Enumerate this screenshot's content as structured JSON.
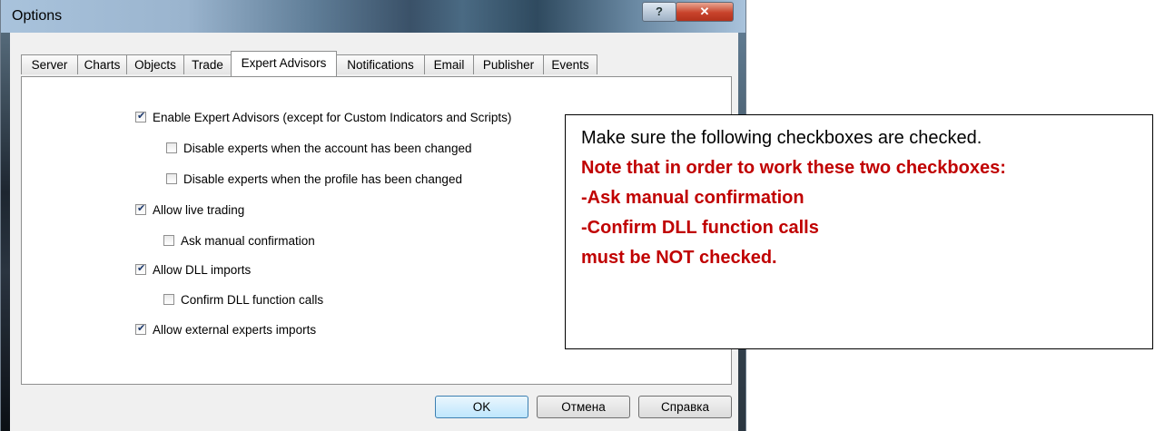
{
  "window": {
    "title": "Options"
  },
  "tabs": [
    "Server",
    "Charts",
    "Objects",
    "Trade",
    "Expert Advisors",
    "Notifications",
    "Email",
    "Publisher",
    "Events"
  ],
  "active_tab": "Expert Advisors",
  "options": [
    {
      "label": "Enable Expert Advisors (except for Custom Indicators and Scripts)",
      "checked": true
    },
    {
      "label": "Disable experts when the account has been changed",
      "checked": false
    },
    {
      "label": "Disable experts when the profile has been changed",
      "checked": false
    },
    {
      "label": "Allow live trading",
      "checked": true
    },
    {
      "label": "Ask manual confirmation",
      "checked": false
    },
    {
      "label": "Allow DLL imports",
      "checked": true
    },
    {
      "label": "Confirm DLL function calls",
      "checked": false
    },
    {
      "label": "Allow external experts imports",
      "checked": true
    }
  ],
  "buttons": {
    "ok": "OK",
    "cancel": "Отмена",
    "help": "Справка"
  },
  "note": {
    "line1": "Make sure the following checkboxes are checked.",
    "line2": "Note that in order to work these two checkboxes:",
    "line3": "-Ask manual confirmation",
    "line4": "-Confirm DLL function calls",
    "line5": "must be NOT checked."
  },
  "colors": {
    "note_red": "#c00000",
    "title_bar": "#3a5168"
  }
}
